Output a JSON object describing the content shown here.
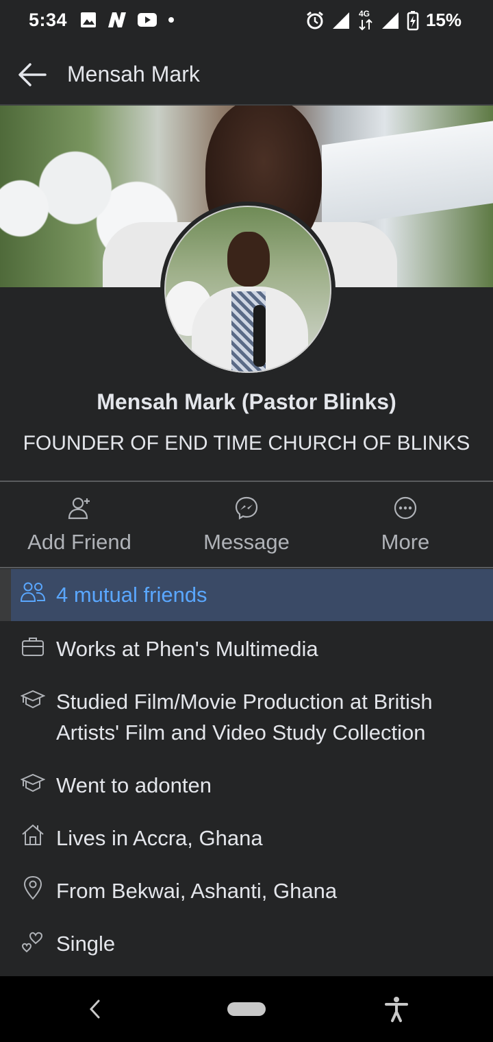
{
  "status_bar": {
    "time": "5:34",
    "battery": "15%",
    "network": "4G"
  },
  "header": {
    "title": "Mensah Mark"
  },
  "profile": {
    "name": "Mensah Mark (Pastor Blinks)",
    "bio": "FOUNDER OF END TIME CHURCH OF BLINKS"
  },
  "actions": [
    {
      "label": "Add Friend",
      "icon": "add-friend-icon"
    },
    {
      "label": "Message",
      "icon": "messenger-icon"
    },
    {
      "label": "More",
      "icon": "more-icon"
    }
  ],
  "mutual": {
    "text": "4 mutual friends",
    "icon": "friends-icon"
  },
  "details": [
    {
      "icon": "briefcase-icon",
      "text": "Works at Phen's Multimedia"
    },
    {
      "icon": "graduation-cap-icon",
      "text": "Studied Film/Movie Production at British Artists' Film and Video Study Collection"
    },
    {
      "icon": "graduation-cap-icon",
      "text": "Went to adonten"
    },
    {
      "icon": "home-icon",
      "text": "Lives in Accra, Ghana"
    },
    {
      "icon": "location-pin-icon",
      "text": "From Bekwai, Ashanti, Ghana"
    },
    {
      "icon": "hearts-icon",
      "text": "Single"
    }
  ],
  "colors": {
    "background": "#242526",
    "mutual_highlight": "#3a4a66",
    "link": "#5aa7ff",
    "text": "#e4e6eb",
    "muted": "#b0b3b8"
  }
}
